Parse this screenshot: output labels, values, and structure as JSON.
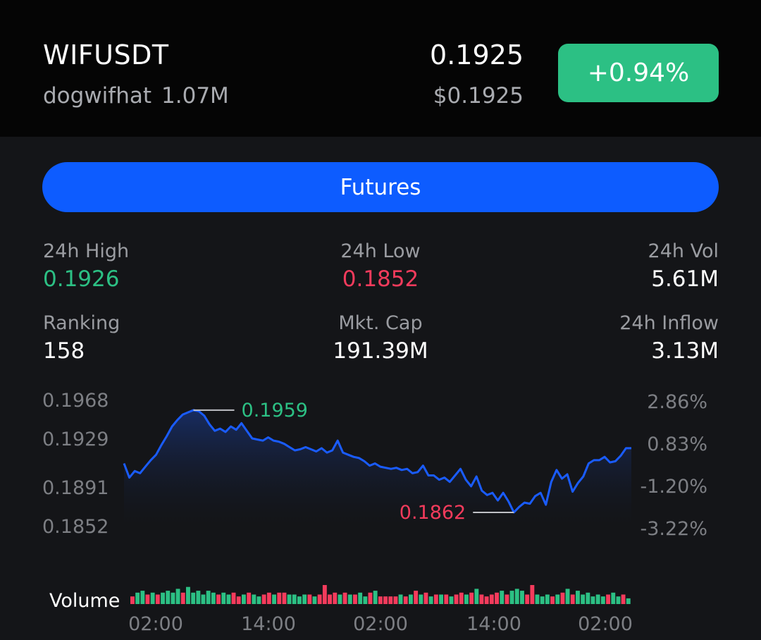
{
  "header": {
    "symbol": "WIFUSDT",
    "name": "dogwifhat",
    "volume": "1.07M",
    "price": "0.1925",
    "usd_price": "$0.1925",
    "change": "+0.94%"
  },
  "futures_label": "Futures",
  "stats": {
    "high_label": "24h High",
    "high_value": "0.1926",
    "low_label": "24h Low",
    "low_value": "0.1852",
    "vol_label": "24h Vol",
    "vol_value": "5.61M",
    "rank_label": "Ranking",
    "rank_value": "158",
    "mcap_label": "Mkt. Cap",
    "mcap_value": "191.39M",
    "inflow_label": "24h Inflow",
    "inflow_value": "3.13M"
  },
  "colors": {
    "up": "#2cc084",
    "down": "#f43b5c",
    "line": "#1a5cff",
    "accent": "#0d5cff"
  },
  "chart_data": {
    "type": "line",
    "y_left_ticks": [
      "0.1968",
      "0.1929",
      "0.1891",
      "0.1852"
    ],
    "y_right_ticks": [
      "2.86%",
      "0.83%",
      "-1.20%",
      "-3.22%"
    ],
    "x_ticks": [
      "02:00",
      "14:00",
      "02:00",
      "14:00",
      "02:00"
    ],
    "ylim": [
      0.1852,
      0.1968
    ],
    "max_label": "0.1959",
    "min_label": "0.1862",
    "volume_label": "Volume",
    "price_series": [
      0.191,
      0.1897,
      0.1903,
      0.1901,
      0.1907,
      0.1913,
      0.1918,
      0.1927,
      0.1935,
      0.1944,
      0.195,
      0.1955,
      0.1957,
      0.1959,
      0.1958,
      0.1954,
      0.1946,
      0.194,
      0.1942,
      0.1939,
      0.1944,
      0.1941,
      0.1947,
      0.194,
      0.1933,
      0.1932,
      0.1931,
      0.1934,
      0.1931,
      0.193,
      0.1928,
      0.1925,
      0.1922,
      0.1923,
      0.1925,
      0.1923,
      0.1921,
      0.1924,
      0.192,
      0.1922,
      0.1931,
      0.192,
      0.1918,
      0.1916,
      0.1915,
      0.1912,
      0.1908,
      0.191,
      0.1907,
      0.1906,
      0.1905,
      0.1906,
      0.1904,
      0.1905,
      0.1901,
      0.1902,
      0.1908,
      0.1899,
      0.1899,
      0.1895,
      0.1897,
      0.1893,
      0.1899,
      0.1905,
      0.1895,
      0.1889,
      0.1898,
      0.1885,
      0.1881,
      0.1883,
      0.1876,
      0.1883,
      0.1875,
      0.1865,
      0.187,
      0.1874,
      0.1873,
      0.188,
      0.1883,
      0.1872,
      0.1893,
      0.1904,
      0.1896,
      0.19,
      0.1884,
      0.1892,
      0.1898,
      0.191,
      0.1913,
      0.1913,
      0.1916,
      0.1911,
      0.1912,
      0.1917,
      0.1924,
      0.1924
    ],
    "volume_series": [
      {
        "v": 0.4,
        "up": false
      },
      {
        "v": 0.6,
        "up": true
      },
      {
        "v": 0.7,
        "up": true
      },
      {
        "v": 0.5,
        "up": false
      },
      {
        "v": 0.6,
        "up": true
      },
      {
        "v": 0.5,
        "up": false
      },
      {
        "v": 0.6,
        "up": true
      },
      {
        "v": 0.7,
        "up": true
      },
      {
        "v": 0.6,
        "up": true
      },
      {
        "v": 0.8,
        "up": true
      },
      {
        "v": 0.6,
        "up": false
      },
      {
        "v": 0.9,
        "up": true
      },
      {
        "v": 0.6,
        "up": true
      },
      {
        "v": 0.7,
        "up": true
      },
      {
        "v": 0.5,
        "up": true
      },
      {
        "v": 0.7,
        "up": true
      },
      {
        "v": 0.6,
        "up": true
      },
      {
        "v": 0.5,
        "up": false
      },
      {
        "v": 0.6,
        "up": true
      },
      {
        "v": 0.5,
        "up": true
      },
      {
        "v": 0.6,
        "up": false
      },
      {
        "v": 0.4,
        "up": false
      },
      {
        "v": 0.5,
        "up": true
      },
      {
        "v": 0.6,
        "up": false
      },
      {
        "v": 0.5,
        "up": true
      },
      {
        "v": 0.4,
        "up": true
      },
      {
        "v": 0.5,
        "up": false
      },
      {
        "v": 0.6,
        "up": false
      },
      {
        "v": 0.5,
        "up": true
      },
      {
        "v": 0.6,
        "up": false
      },
      {
        "v": 0.6,
        "up": false
      },
      {
        "v": 0.5,
        "up": true
      },
      {
        "v": 0.5,
        "up": true
      },
      {
        "v": 0.4,
        "up": true
      },
      {
        "v": 0.5,
        "up": true
      },
      {
        "v": 0.5,
        "up": false
      },
      {
        "v": 0.4,
        "up": true
      },
      {
        "v": 0.5,
        "up": false
      },
      {
        "v": 1.0,
        "up": false
      },
      {
        "v": 0.5,
        "up": false
      },
      {
        "v": 0.6,
        "up": false
      },
      {
        "v": 0.5,
        "up": true
      },
      {
        "v": 0.6,
        "up": false
      },
      {
        "v": 0.5,
        "up": true
      },
      {
        "v": 0.5,
        "up": false
      },
      {
        "v": 0.6,
        "up": true
      },
      {
        "v": 0.4,
        "up": true
      },
      {
        "v": 0.6,
        "up": false
      },
      {
        "v": 0.7,
        "up": true
      },
      {
        "v": 0.4,
        "up": false
      },
      {
        "v": 0.4,
        "up": false
      },
      {
        "v": 0.4,
        "up": false
      },
      {
        "v": 0.4,
        "up": false
      },
      {
        "v": 0.5,
        "up": true
      },
      {
        "v": 0.4,
        "up": false
      },
      {
        "v": 0.5,
        "up": true
      },
      {
        "v": 0.7,
        "up": false
      },
      {
        "v": 0.5,
        "up": true
      },
      {
        "v": 0.6,
        "up": false
      },
      {
        "v": 0.4,
        "up": true
      },
      {
        "v": 0.5,
        "up": false
      },
      {
        "v": 0.5,
        "up": true
      },
      {
        "v": 0.5,
        "up": false
      },
      {
        "v": 0.4,
        "up": true
      },
      {
        "v": 0.5,
        "up": false
      },
      {
        "v": 0.6,
        "up": false
      },
      {
        "v": 0.5,
        "up": true
      },
      {
        "v": 0.6,
        "up": false
      },
      {
        "v": 0.8,
        "up": true
      },
      {
        "v": 0.5,
        "up": false
      },
      {
        "v": 0.4,
        "up": false
      },
      {
        "v": 0.5,
        "up": false
      },
      {
        "v": 0.6,
        "up": false
      },
      {
        "v": 0.7,
        "up": true
      },
      {
        "v": 0.5,
        "up": false
      },
      {
        "v": 0.7,
        "up": true
      },
      {
        "v": 0.8,
        "up": true
      },
      {
        "v": 0.7,
        "up": true
      },
      {
        "v": 0.5,
        "up": false
      },
      {
        "v": 1.0,
        "up": false
      },
      {
        "v": 0.5,
        "up": true
      },
      {
        "v": 0.4,
        "up": true
      },
      {
        "v": 0.5,
        "up": true
      },
      {
        "v": 0.4,
        "up": false
      },
      {
        "v": 0.5,
        "up": true
      },
      {
        "v": 0.6,
        "up": false
      },
      {
        "v": 0.8,
        "up": true
      },
      {
        "v": 0.5,
        "up": false
      },
      {
        "v": 0.7,
        "up": true
      },
      {
        "v": 0.5,
        "up": true
      },
      {
        "v": 0.6,
        "up": true
      },
      {
        "v": 0.4,
        "up": true
      },
      {
        "v": 0.5,
        "up": true
      },
      {
        "v": 0.4,
        "up": true
      },
      {
        "v": 0.5,
        "up": false
      },
      {
        "v": 0.6,
        "up": true
      },
      {
        "v": 0.4,
        "up": true
      },
      {
        "v": 0.5,
        "up": false
      },
      {
        "v": 0.3,
        "up": true
      }
    ]
  }
}
